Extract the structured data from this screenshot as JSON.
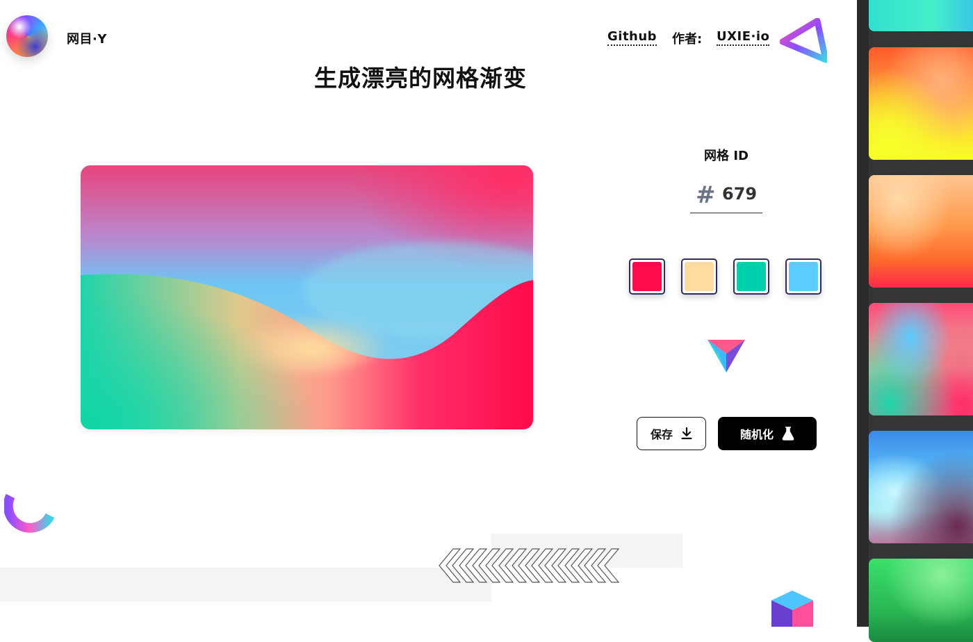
{
  "header": {
    "brand": "网目·Y",
    "github_label": "Github",
    "author_label": "作者:",
    "author_name": "UXIE·io"
  },
  "title": "生成漂亮的网格渐变",
  "mesh": {
    "id_label": "网格 ID",
    "hash_symbol": "#",
    "id_value": "679",
    "colors": [
      "#ff0a4a",
      "#ffdc9e",
      "#00cfac",
      "#5ccbff"
    ]
  },
  "actions": {
    "save_label": "保存",
    "randomize_label": "随机化"
  },
  "icons": {
    "logo": "gradient-orb-logo",
    "corner": "gradient-triangle-icon",
    "prism": "prism-icon",
    "save": "download-icon",
    "randomize": "flask-icon",
    "arc": "gradient-arc-decoration",
    "chevrons": "chevron-pattern-decoration",
    "cube": "gradient-cube-decoration"
  }
}
